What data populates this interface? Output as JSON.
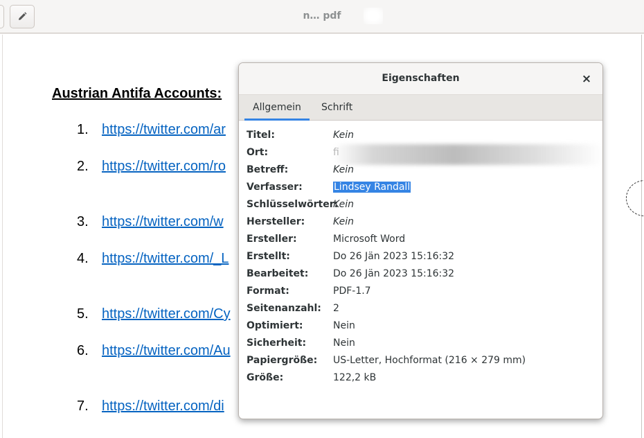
{
  "header": {
    "title": "n… pdf"
  },
  "document": {
    "heading": "Austrian Antifa Accounts:",
    "items": [
      {
        "num": "1.",
        "link": "https://twitter.com/ar"
      },
      {
        "num": "2.",
        "link": "https://twitter.com/ro"
      },
      {
        "num": "3.",
        "link": "https://twitter.com/w"
      },
      {
        "num": "4.",
        "link": "https://twitter.com/_L"
      },
      {
        "num": "5.",
        "link": "https://twitter.com/Cy"
      },
      {
        "num": "6.",
        "link": "https://twitter.com/Au"
      },
      {
        "num": "7.",
        "link": "https://twitter.com/di"
      }
    ]
  },
  "dialog": {
    "title": "Eigenschaften",
    "close_label": "×",
    "tabs": [
      {
        "label": "Allgemein",
        "active": true
      },
      {
        "label": "Schrift",
        "active": false
      }
    ],
    "properties": [
      {
        "label": "Titel:",
        "value": "Kein",
        "style": "italic"
      },
      {
        "label": "Ort:",
        "value": "fi",
        "style": "redacted"
      },
      {
        "label": "Betreff:",
        "value": "Kein",
        "style": "italic"
      },
      {
        "label": "Verfasser:",
        "value": "Lindsey Randall",
        "style": "selected"
      },
      {
        "label": "Schlüsselwörter:",
        "value": "Kein",
        "style": "italic"
      },
      {
        "label": "Hersteller:",
        "value": "Kein",
        "style": "italic"
      },
      {
        "label": "Ersteller:",
        "value": "Microsoft Word",
        "style": "normal"
      },
      {
        "label": "Erstellt:",
        "value": "Do 26 Jän 2023 15:16:32",
        "style": "normal"
      },
      {
        "label": "Bearbeitet:",
        "value": "Do 26 Jän 2023 15:16:32",
        "style": "normal"
      },
      {
        "label": "Format:",
        "value": "PDF-1.7",
        "style": "normal"
      },
      {
        "label": "Seitenanzahl:",
        "value": "2",
        "style": "normal"
      },
      {
        "label": "Optimiert:",
        "value": "Nein",
        "style": "normal"
      },
      {
        "label": "Sicherheit:",
        "value": "Nein",
        "style": "normal"
      },
      {
        "label": "Papiergröße:",
        "value": "US-Letter, Hochformat (216 × 279 mm)",
        "style": "normal"
      },
      {
        "label": "Größe:",
        "value": "122,2 kB",
        "style": "normal"
      }
    ]
  },
  "colors": {
    "accent": "#3584e4",
    "link": "#0563c1"
  },
  "icons": {
    "edit": "pencil-icon",
    "close": "close-icon"
  }
}
